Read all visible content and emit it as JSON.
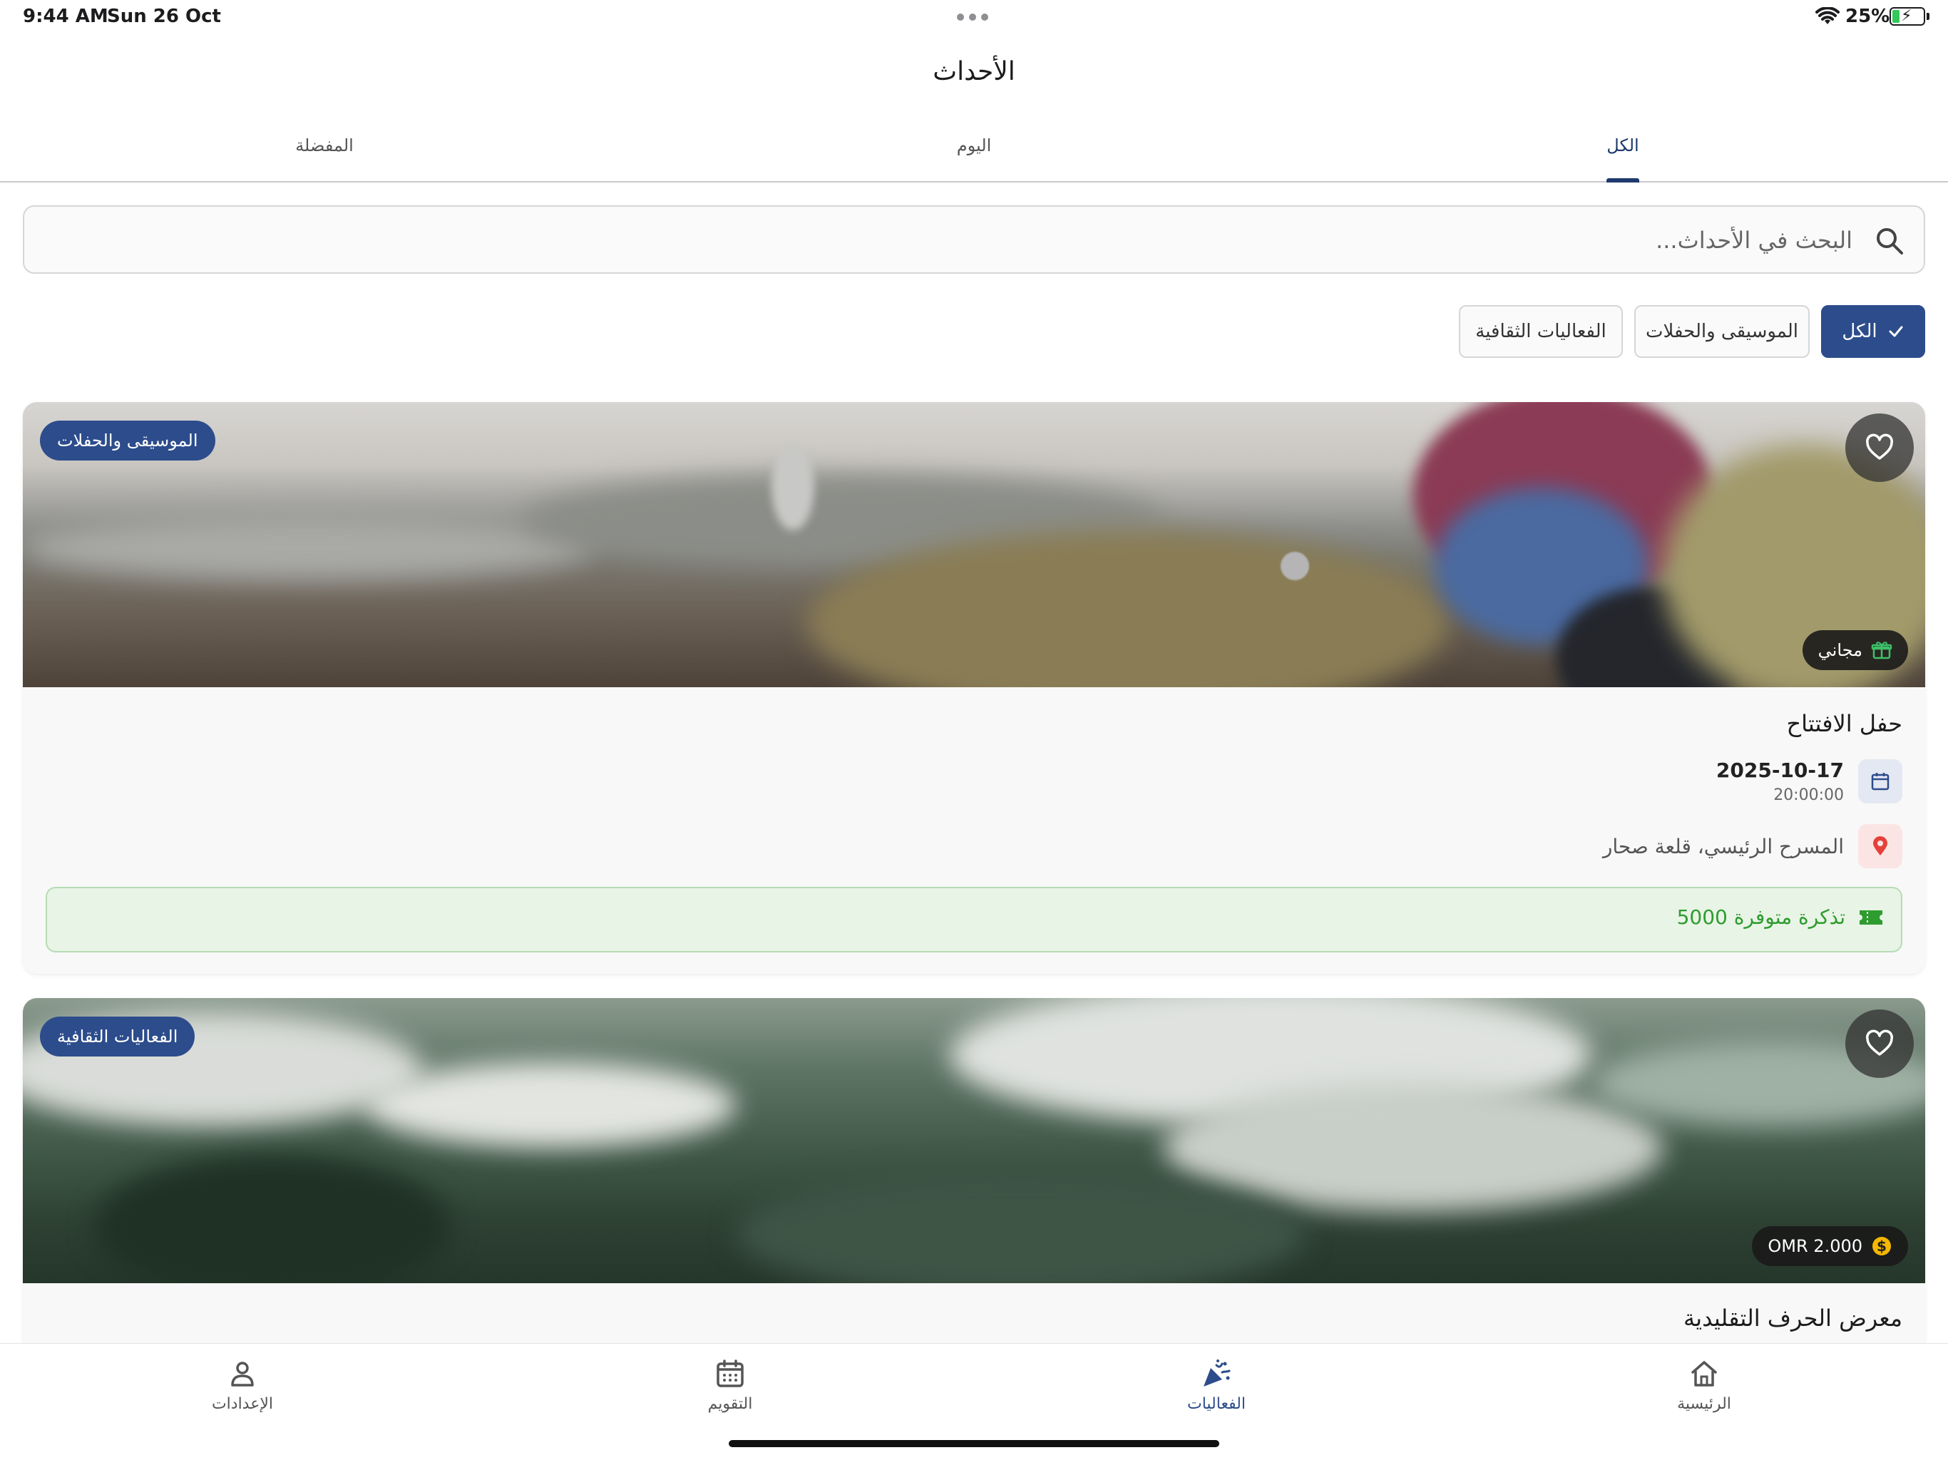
{
  "status_bar": {
    "time": "9:44 AM",
    "date": "Sun 26 Oct",
    "battery_percent": "25%"
  },
  "header": {
    "title": "الأحداث"
  },
  "tabs": [
    {
      "label": "الكل",
      "active": true
    },
    {
      "label": "اليوم",
      "active": false
    },
    {
      "label": "المفضلة",
      "active": false
    }
  ],
  "search": {
    "placeholder": "البحث في الأحداث..."
  },
  "filters": [
    {
      "label": "الكل",
      "selected": true
    },
    {
      "label": "الموسيقى والحفلات",
      "selected": false
    },
    {
      "label": "الفعاليات الثقافية",
      "selected": false
    }
  ],
  "events": [
    {
      "category": "الموسيقى والحفلات",
      "price": "مجاني",
      "price_icon": "gift-icon",
      "title": "حفل الافتتاح",
      "date": "2025-10-17",
      "time": "20:00:00",
      "location": "المسرح الرئيسي، قلعة صحار",
      "tickets": "5000 تذكرة متوفرة"
    },
    {
      "category": "الفعاليات الثقافية",
      "price": "OMR 2.000",
      "price_icon": "dollar-coin-icon",
      "title": "معرض الحرف التقليدية"
    }
  ],
  "bottom_nav": [
    {
      "label": "الرئيسية",
      "icon": "home-icon"
    },
    {
      "label": "الفعاليات",
      "icon": "party-popper-icon",
      "active": true
    },
    {
      "label": "التقويم",
      "icon": "calendar-icon"
    },
    {
      "label": "الإعدادات",
      "icon": "person-icon"
    }
  ],
  "colors": {
    "primary": "#2c4c8c",
    "tab_active": "#1e3a6e",
    "success": "#2e9c2e",
    "location_red": "#e5413a"
  }
}
